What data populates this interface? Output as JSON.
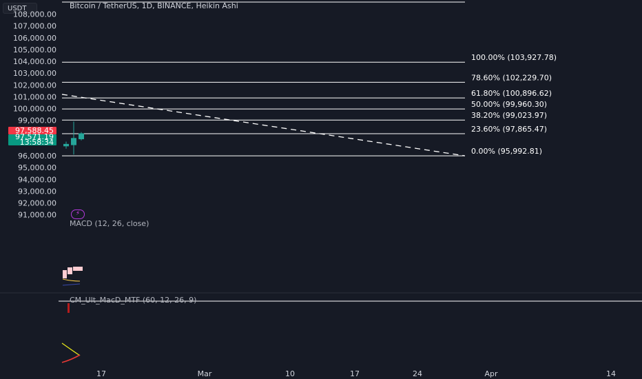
{
  "header": {
    "currency": "USDT",
    "title": "Bitcoin / TetherUS, 1D, BINANCE, Heikin Ashi"
  },
  "price_tags": {
    "last_price": "97,588.45",
    "current_price": "97,571.19",
    "countdown": "13:58:34",
    "last_color": "#f23645",
    "current_color": "#089981"
  },
  "indicators": {
    "macd": "MACD (12, 26, close)",
    "cm_ult_macd": "CM_Ult_MacD_MTF (60, 12, 26, 9)",
    "alert_icon": "lightning-bolt-icon"
  },
  "chart_data": {
    "type": "fibonacci",
    "y_axis_labels": [
      "108,000.00",
      "107,000.00",
      "106,000.00",
      "105,000.00",
      "104,000.00",
      "103,000.00",
      "102,000.00",
      "101,000.00",
      "100,000.00",
      "99,000.00",
      "98,000.00",
      "96,000.00",
      "95,000.00",
      "94,000.00",
      "93,000.00",
      "92,000.00",
      "91,000.00"
    ],
    "ylim": [
      91000,
      108500
    ],
    "x_axis_labels": [
      "17",
      "Mar",
      "10",
      "17",
      "24",
      "Apr",
      "14"
    ],
    "fib_levels": [
      {
        "ratio": 1.0,
        "label": "100.00% (103,927.78)",
        "price": 103927.78
      },
      {
        "ratio": 0.786,
        "label": "78.60% (102,229.70)",
        "price": 102229.7
      },
      {
        "ratio": 0.618,
        "label": "61.80% (100,896.62)",
        "price": 100896.62
      },
      {
        "ratio": 0.5,
        "label": "50.00% (99,960.30)",
        "price": 99960.3
      },
      {
        "ratio": 0.382,
        "label": "38.20% (99,023.97)",
        "price": 99023.97
      },
      {
        "ratio": 0.236,
        "label": "23.60% (97,865.47)",
        "price": 97865.47
      },
      {
        "ratio": 0.0,
        "label": "0.00% (95,992.81)",
        "price": 95992.81
      }
    ],
    "trend_line": {
      "start_price": 101200,
      "end_price": 95992.81,
      "style": "dashed"
    },
    "candles": [
      {
        "open": 97000,
        "high": 97200,
        "low": 96600,
        "close": 96800,
        "color": "#26a69a"
      },
      {
        "open": 96900,
        "high": 98900,
        "low": 96100,
        "close": 97500,
        "color": "#26a69a"
      },
      {
        "open": 97400,
        "high": 98000,
        "low": 97300,
        "close": 97900,
        "color": "#26a69a"
      }
    ],
    "colors": {
      "fib_line": "#ffffff",
      "trend_line": "#ffffff",
      "background": "#161a25"
    }
  }
}
